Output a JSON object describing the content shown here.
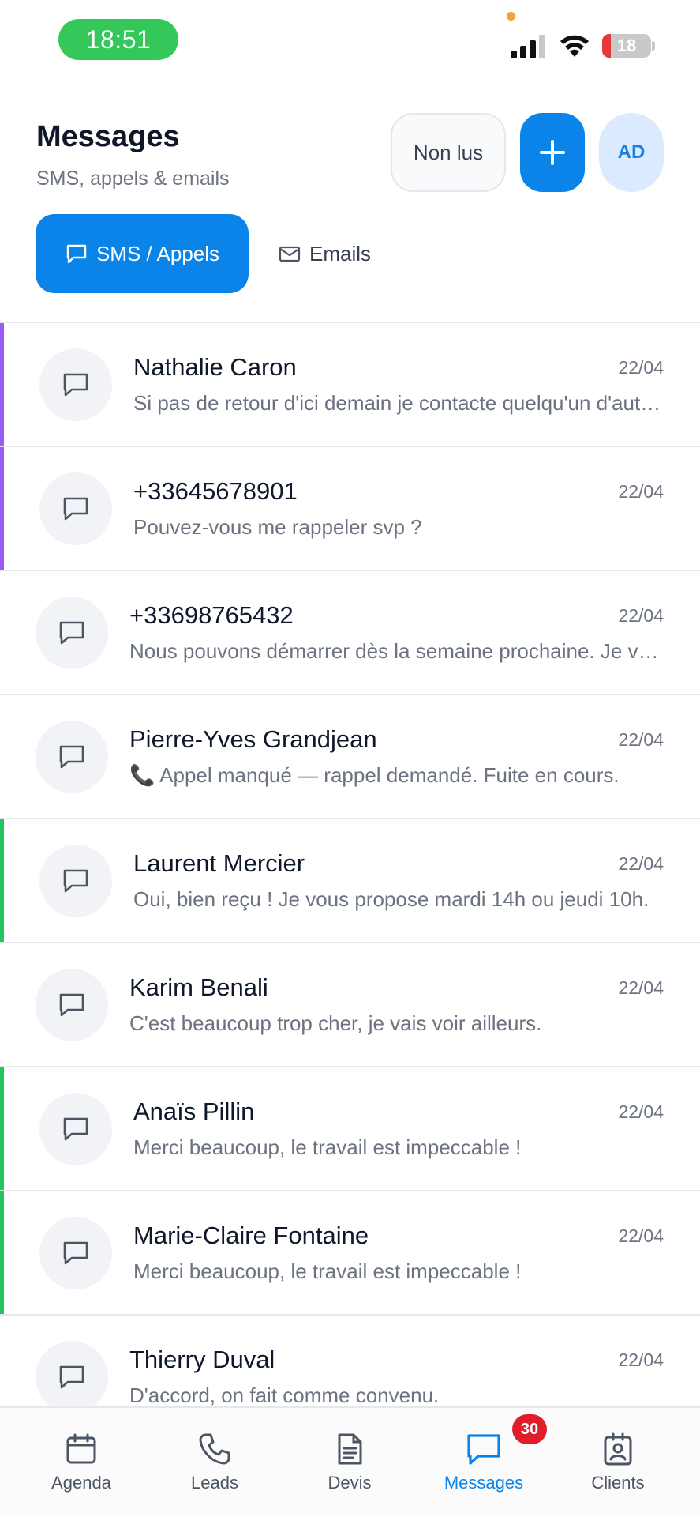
{
  "status_bar": {
    "time": "18:51",
    "battery": "18"
  },
  "header": {
    "title": "Messages",
    "subtitle": "SMS, appels & emails",
    "unread_label": "Non lus",
    "avatar_initials": "AD"
  },
  "tabs": [
    {
      "label": "SMS / Appels",
      "active": true
    },
    {
      "label": "Emails",
      "active": false
    }
  ],
  "messages": [
    {
      "name": "Nathalie Caron",
      "date": "22/04",
      "preview": "Si pas de retour d'ici demain je contacte quelqu'un d'autre.",
      "accent": "#9b59f6"
    },
    {
      "name": "+33645678901",
      "date": "22/04",
      "preview": "Pouvez-vous me rappeler svp ?",
      "accent": "#9b59f6"
    },
    {
      "name": "+33698765432",
      "date": "22/04",
      "preview": "Nous pouvons démarrer dès la semaine prochaine. Je vous envoie le devis.",
      "accent": ""
    },
    {
      "name": "Pierre-Yves Grandjean",
      "date": "22/04",
      "preview": "📞 Appel manqué — rappel demandé. Fuite en cours.",
      "accent": ""
    },
    {
      "name": "Laurent Mercier",
      "date": "22/04",
      "preview": "Oui, bien reçu ! Je vous propose mardi 14h ou jeudi 10h.",
      "accent": "#22c55e"
    },
    {
      "name": "Karim Benali",
      "date": "22/04",
      "preview": "C'est beaucoup trop cher, je vais voir ailleurs.",
      "accent": ""
    },
    {
      "name": "Anaïs Pillin",
      "date": "22/04",
      "preview": "Merci beaucoup, le travail est impeccable !",
      "accent": "#22c55e"
    },
    {
      "name": "Marie-Claire Fontaine",
      "date": "22/04",
      "preview": "Merci beaucoup, le travail est impeccable !",
      "accent": "#22c55e"
    },
    {
      "name": "Thierry Duval",
      "date": "22/04",
      "preview": "D'accord, on fait comme convenu.",
      "accent": ""
    }
  ],
  "nav": [
    {
      "label": "Agenda",
      "icon": "calendar-icon",
      "active": false
    },
    {
      "label": "Leads",
      "icon": "phone-icon",
      "active": false
    },
    {
      "label": "Devis",
      "icon": "document-icon",
      "active": false
    },
    {
      "label": "Messages",
      "icon": "chat-icon",
      "active": true
    },
    {
      "label": "Clients",
      "icon": "contact-card-icon",
      "active": false
    }
  ],
  "messages_badge": "30",
  "colors": {
    "primary": "#0a84e8",
    "unread_accent": "#9b59f6",
    "positive_accent": "#22c55e",
    "badge": "#e11d2a"
  }
}
